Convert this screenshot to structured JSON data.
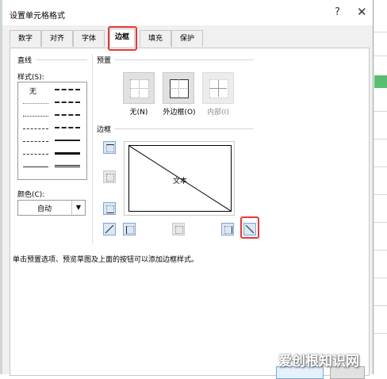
{
  "dialog": {
    "title": "设置单元格格式",
    "help_glyph": "?",
    "close_glyph": "✕"
  },
  "tabs": [
    {
      "label": "数字"
    },
    {
      "label": "对齐"
    },
    {
      "label": "字体"
    },
    {
      "label": "边框",
      "active": true
    },
    {
      "label": "填充"
    },
    {
      "label": "保护"
    }
  ],
  "line": {
    "group_label": "直线",
    "style_label": "样式(S):",
    "none_label": "无",
    "color_label": "颜色(C):",
    "color_value": "自动"
  },
  "presets": {
    "group_label": "预置",
    "items": [
      {
        "label": "无(N)"
      },
      {
        "label": "外边框(O)"
      },
      {
        "label": "内部(I)"
      }
    ]
  },
  "border": {
    "group_label": "边框",
    "preview_text": "文本"
  },
  "hint": "单击预置选项、预览草图及上面的按钮可以添加边框样式。",
  "watermark": "爱创根知识网",
  "colors": {
    "highlight": "#e53935",
    "button_fill": "#dbe7f5",
    "button_border": "#7aa7d9"
  }
}
